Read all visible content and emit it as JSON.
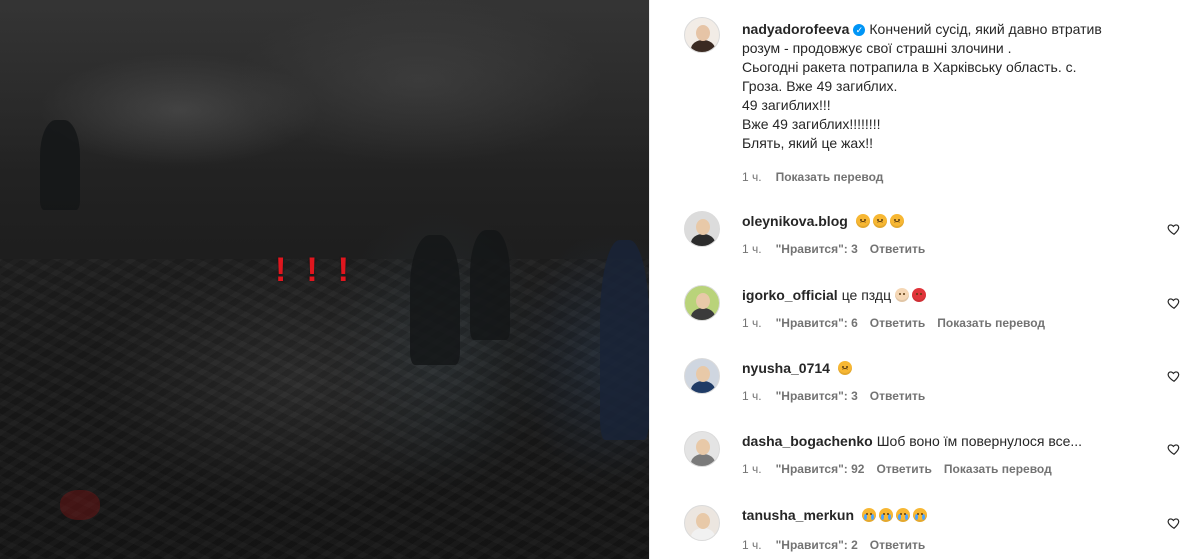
{
  "post": {
    "exclamation_marks": [
      "!",
      "!",
      "!"
    ]
  },
  "caption": {
    "username": "nadyadorofeeva",
    "text_first": "Кончений сусід, який давно втратив",
    "lines": [
      "розум - продовжує свої страшні злочини .",
      "Сьогодні ракета потрапила в Харківську область. с.",
      "Гроза. Вже 49 загиблих.",
      "49 загиблих!!!",
      "Вже 49 загиблих!!!!!!!!",
      "Блять, який це жах!!"
    ],
    "time": "1 ч.",
    "translate": "Показать перевод",
    "avatar_icon": "woman-portrait-avatar"
  },
  "comments": [
    {
      "username": "oleynikova.blog",
      "text": "",
      "emojis": [
        "sad-face-icon",
        "sad-face-icon",
        "sad-face-icon"
      ],
      "time": "1 ч.",
      "likes": "\"Нравится\": 3",
      "reply": "Ответить",
      "translate": ""
    },
    {
      "username": "igorko_official",
      "text": "це пздц",
      "emojis": [
        "exploding-head-icon",
        "angry-face-icon"
      ],
      "time": "1 ч.",
      "likes": "\"Нравится\": 6",
      "reply": "Ответить",
      "translate": "Показать перевод"
    },
    {
      "username": "nyusha_0714",
      "text": "",
      "emojis": [
        "sad-face-icon"
      ],
      "time": "1 ч.",
      "likes": "\"Нравится\": 3",
      "reply": "Ответить",
      "translate": ""
    },
    {
      "username": "dasha_bogachenko",
      "text": "Шоб воно їм повернулося все...",
      "emojis": [],
      "time": "1 ч.",
      "likes": "\"Нравится\": 92",
      "reply": "Ответить",
      "translate": "Показать перевод"
    },
    {
      "username": "tanusha_merkun",
      "text": "",
      "emojis": [
        "crying-face-icon",
        "crying-face-icon",
        "crying-face-icon",
        "crying-face-icon"
      ],
      "time": "1 ч.",
      "likes": "\"Нравится\": 2",
      "reply": "Ответить",
      "translate": ""
    }
  ],
  "colors": {
    "text_primary": "#262626",
    "text_secondary": "#737373",
    "verified": "#0095f6",
    "exclamation": "#e0161e"
  }
}
